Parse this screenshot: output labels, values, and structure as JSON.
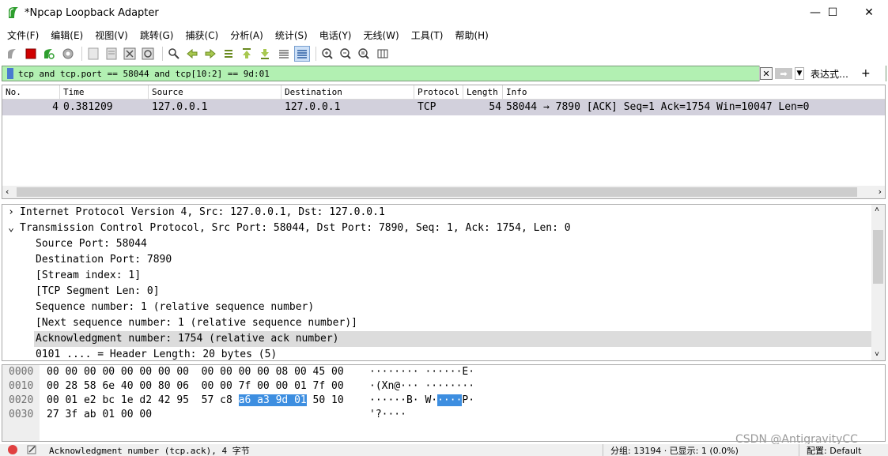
{
  "window": {
    "title": "*Npcap Loopback Adapter",
    "min_glyph": "—",
    "max_glyph": "☐",
    "close_glyph": "✕"
  },
  "menu": [
    "文件(F)",
    "编辑(E)",
    "视图(V)",
    "跳转(G)",
    "捕获(C)",
    "分析(A)",
    "统计(S)",
    "电话(Y)",
    "无线(W)",
    "工具(T)",
    "帮助(H)"
  ],
  "toolbar": {
    "icons": [
      "shark-fin-icon",
      "stop-icon",
      "restart-icon",
      "options-icon",
      "open-file-icon",
      "save-icon",
      "close-file-icon",
      "reload-icon",
      "find-icon",
      "back-icon",
      "forward-icon",
      "go-to-packet-icon",
      "first-packet-icon",
      "last-packet-icon",
      "autoscroll-icon",
      "colorize-icon",
      "zoom-in-icon",
      "zoom-out-icon",
      "zoom-reset-icon",
      "resize-columns-icon"
    ]
  },
  "filter": {
    "value": "tcp and tcp.port == 58044 and tcp[10:2] == 9d:01",
    "expression_label": "表达式…",
    "add_glyph": "+"
  },
  "packet_list": {
    "columns": [
      "No.",
      "Time",
      "Source",
      "Destination",
      "Protocol",
      "Length",
      "Info"
    ],
    "rows": [
      {
        "no": "4",
        "time": "0.381209",
        "source": "127.0.0.1",
        "destination": "127.0.0.1",
        "protocol": "TCP",
        "length": "54",
        "info": "58044 → 7890 [ACK] Seq=1 Ack=1754 Win=10047 Len=0"
      }
    ]
  },
  "details": {
    "lines": [
      "Internet Protocol Version 4, Src: 127.0.0.1, Dst: 127.0.0.1",
      "Transmission Control Protocol, Src Port: 58044, Dst Port: 7890, Seq: 1, Ack: 1754, Len: 0",
      "Source Port: 58044",
      "Destination Port: 7890",
      "[Stream index: 1]",
      "[TCP Segment Len: 0]",
      "Sequence number: 1    (relative sequence number)",
      "[Next sequence number: 1    (relative sequence number)]",
      "Acknowledgment number: 1754    (relative ack number)",
      "0101 .... = Header Length: 20 bytes (5)"
    ]
  },
  "bytes": {
    "offsets": [
      "0000",
      "0010",
      "0020",
      "0030"
    ],
    "row0_hex": "00 00 00 00 00 00 00 00  00 00 00 00 08 00 45 00",
    "row0_ascii": "········ ······E·",
    "row1_hex": "00 28 58 6e 40 00 80 06  00 00 7f 00 00 01 7f 00",
    "row1_ascii": "·(Xn@··· ········",
    "row2_hex_pre": "00 01 e2 bc 1e d2 42 95  57 c8 ",
    "row2_hex_sel": "a6 a3 9d 01",
    "row2_hex_post": " 50 10",
    "row2_ascii_pre": "······B· W·",
    "row2_ascii_sel": "····",
    "row2_ascii_post": "P·",
    "row3_hex": "27 3f ab 01 00 00",
    "row3_ascii": "'?····"
  },
  "status": {
    "field_text": "Acknowledgment number (tcp.ack), 4 字节",
    "packets": "分组: 13194 · 已显示: 1 (0.0%)",
    "profile": "配置: Default"
  },
  "watermark": "CSDN @AntigravityCC",
  "colors": {
    "filter_ok": "#b2f0b2",
    "selected_row": "#d2d0dc",
    "byte_highlight": "#3d8ee0",
    "stop_red": "#d00000",
    "shark_green": "#2e9e2e"
  }
}
